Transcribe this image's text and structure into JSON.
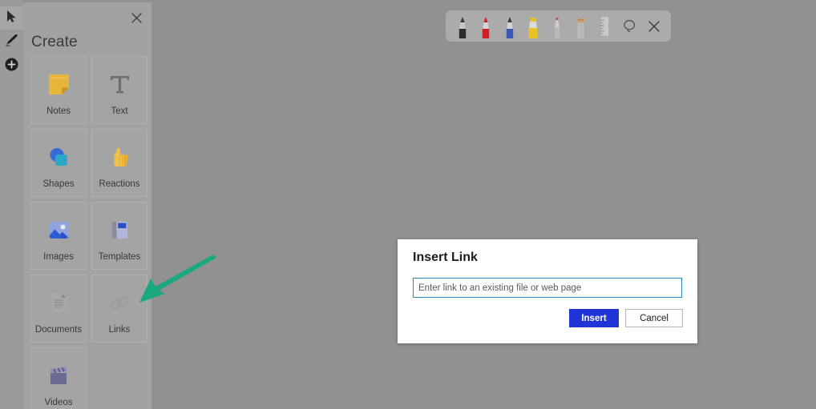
{
  "canvas": {
    "overlay_color": "#919191"
  },
  "left_rail": {
    "items": [
      {
        "name": "pointer",
        "icon": "pointer-icon",
        "selected": true
      },
      {
        "name": "pen",
        "icon": "pen-icon",
        "selected": false
      },
      {
        "name": "add",
        "icon": "plus-circle-icon",
        "selected": false
      }
    ]
  },
  "create_panel": {
    "title": "Create",
    "close_label": "✕",
    "tiles": [
      {
        "label": "Notes",
        "icon": "sticky-note-icon"
      },
      {
        "label": "Text",
        "icon": "text-t-icon"
      },
      {
        "label": "Shapes",
        "icon": "shapes-icon"
      },
      {
        "label": "Reactions",
        "icon": "thumbs-up-icon"
      },
      {
        "label": "Images",
        "icon": "image-icon"
      },
      {
        "label": "Templates",
        "icon": "templates-icon"
      },
      {
        "label": "Documents",
        "icon": "document-icon"
      },
      {
        "label": "Links",
        "icon": "chain-link-icon"
      },
      {
        "label": "Videos",
        "icon": "clapperboard-icon"
      }
    ]
  },
  "pen_toolbar": {
    "pens": [
      {
        "name": "black-pen",
        "color": "#2d2d2d"
      },
      {
        "name": "red-pen",
        "color": "#cf2027"
      },
      {
        "name": "blue-pen",
        "color": "#3a58b5"
      },
      {
        "name": "yellow-highlighter",
        "color": "#e8c222"
      },
      {
        "name": "eraser",
        "color": "#c0504d"
      },
      {
        "name": "pencil",
        "color": "#d2a06a"
      }
    ],
    "tools": [
      {
        "name": "ruler-icon",
        "label": "Ruler"
      },
      {
        "name": "lasso-select-icon",
        "label": "Lasso select"
      },
      {
        "name": "close-icon",
        "label": "✕"
      }
    ]
  },
  "annotation": {
    "arrow_color": "#1aa87e",
    "points_to": "Links"
  },
  "dialog": {
    "title": "Insert Link",
    "input_value": "",
    "input_placeholder": "Enter link to an existing file or web page",
    "primary_button": "Insert",
    "secondary_button": "Cancel",
    "primary_color": "#1f35d8"
  }
}
